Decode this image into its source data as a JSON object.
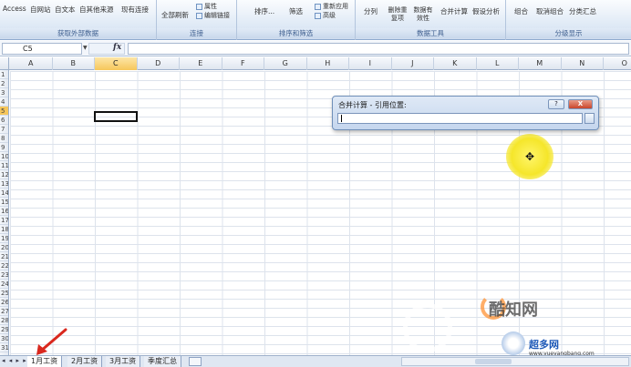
{
  "ribbon": {
    "groups": [
      {
        "label": "获取外部数据",
        "buttons": [
          "Access",
          "自网站",
          "自文本",
          "自其他来源",
          "现有连接"
        ]
      },
      {
        "label": "连接",
        "buttons": [
          "全部刷新",
          "属性",
          "编辑链接"
        ]
      },
      {
        "label": "排序和筛选",
        "buttons": [
          "排序...",
          "筛选",
          "重新应用",
          "高级"
        ]
      },
      {
        "label": "数据工具",
        "buttons": [
          "分列",
          "删除重复项",
          "数据有效性",
          "合并计算",
          "假设分析"
        ]
      },
      {
        "label": "分级显示",
        "buttons": [
          "组合",
          "取消组合",
          "分类汇总"
        ]
      }
    ]
  },
  "formula_bar": {
    "name_box": "C5",
    "fx": "fx",
    "content": ""
  },
  "grid": {
    "columns": [
      "A",
      "B",
      "C",
      "D",
      "E",
      "F",
      "G",
      "H",
      "I",
      "J",
      "K",
      "L",
      "M",
      "N",
      "O"
    ],
    "selected_column": "C",
    "rows": [
      "1",
      "2",
      "3",
      "4",
      "5",
      "6",
      "7",
      "8",
      "9",
      "10",
      "11",
      "12",
      "13",
      "14",
      "15",
      "16",
      "17",
      "18",
      "19",
      "20",
      "21",
      "22",
      "23",
      "24",
      "25",
      "26",
      "27",
      "28",
      "29",
      "30",
      "31"
    ],
    "selected_row": "5"
  },
  "dialog": {
    "title": "合并计算 - 引用位置:",
    "help_btn": "?",
    "close_btn": "X",
    "input_value": ""
  },
  "sheets": {
    "nav": "◂ ◂ ▸ ▸",
    "tabs": [
      "1月工资",
      "2月工资",
      "3月工资",
      "季度汇总"
    ],
    "active": "1月工资"
  },
  "watermarks": {
    "brand1": "酷知网",
    "brand2": "超多网",
    "url": "www.yueyangbang.com"
  },
  "colors": {
    "selected_header": "#f6c65a",
    "annotation_arrow": "#d9281e",
    "cursor_halo": "#f5e62a"
  }
}
